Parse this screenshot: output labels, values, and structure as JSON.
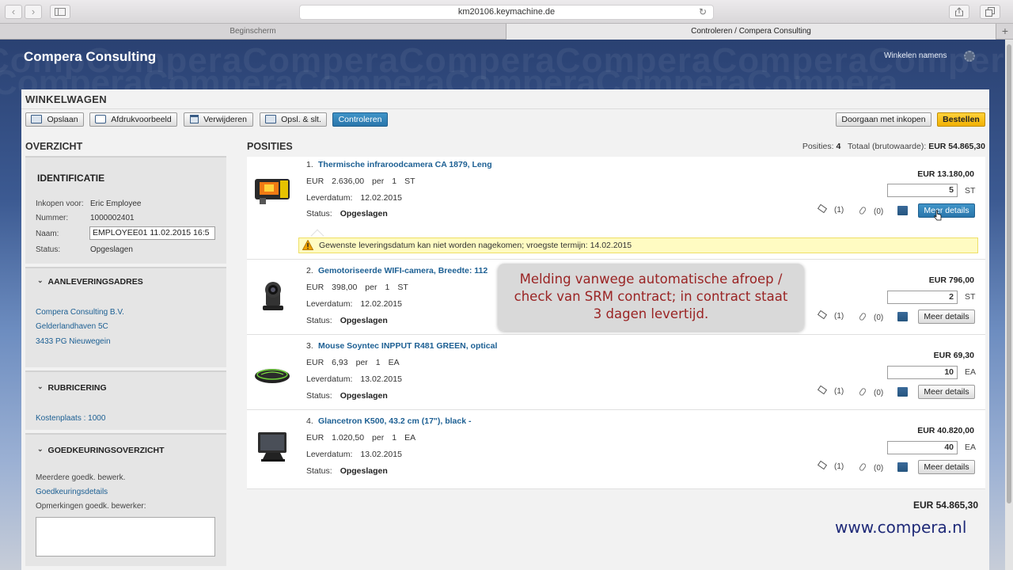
{
  "browser": {
    "url": "km20106.keymachine.de",
    "tabs": [
      {
        "label": "Beginscherm",
        "active": false
      },
      {
        "label": "Controleren / Compera Consulting",
        "active": true
      }
    ]
  },
  "header": {
    "company": "Compera Consulting",
    "shop_for": "Winkelen namens"
  },
  "cart": {
    "title": "WINKELWAGEN",
    "toolbar": {
      "save": "Opslaan",
      "print_preview": "Afdrukvoorbeeld",
      "delete": "Verwijderen",
      "save_close": "Opsl. & slt.",
      "check": "Controleren",
      "continue_shopping": "Doorgaan met inkopen",
      "order": "Bestellen"
    }
  },
  "overview": {
    "title": "OVERZICHT",
    "identification": {
      "title": "IDENTIFICATIE",
      "buy_for_label": "Inkopen voor:",
      "buy_for_value": "Eric Employee",
      "number_label": "Nummer:",
      "number_value": "1000002401",
      "name_label": "Naam:",
      "name_value": "EMPLOYEE01 11.02.2015 16:5",
      "status_label": "Status:",
      "status_value": "Opgeslagen"
    },
    "delivery": {
      "title": "AANLEVERINGSADRES",
      "line1": "Compera Consulting B.V.",
      "line2": "Gelderlandhaven  5C",
      "line3": "3433 PG  Nieuwegein"
    },
    "classification": {
      "title": "RUBRICERING",
      "cost_center": "Kostenplaats : 1000"
    },
    "approval": {
      "title": "GOEDKEURINGSOVERZICHT",
      "multiple": "Meerdere goedk. bewerk.",
      "details_link": "Goedkeuringsdetails",
      "remarks_label": "Opmerkingen goedk. bewerker:"
    }
  },
  "positions": {
    "title": "POSITIES",
    "count_label": "Posities:",
    "count": "4",
    "total_label": "Totaal (brutowaarde):",
    "total_value": "EUR  54.865,30",
    "grand_total": "EUR  54.865,30",
    "delivery_label": "Leverdatum:",
    "status_label": "Status:",
    "more_label": "Meer details",
    "items": [
      {
        "num": "1.",
        "name": "Thermische infraroodcamera CA 1879, Leng",
        "currency": "EUR",
        "price": "2.636,00",
        "per": "per",
        "per_qty": "1",
        "per_unit": "ST",
        "delivery": "12.02.2015",
        "status": "Opgeslagen",
        "total": "EUR   13.180,00",
        "qty": "5",
        "unit": "ST",
        "notes": "(1)",
        "attachments": "(0)"
      },
      {
        "num": "2.",
        "name": "Gemotoriseerde WIFI-camera, Breedte: 112",
        "currency": "EUR",
        "price": "398,00",
        "per": "per",
        "per_qty": "1",
        "per_unit": "ST",
        "delivery": "12.02.2015",
        "status": "Opgeslagen",
        "total": "EUR   796,00",
        "qty": "2",
        "unit": "ST",
        "notes": "(1)",
        "attachments": "(0)"
      },
      {
        "num": "3.",
        "name": "Mouse Soyntec INPPUT R481 GREEN, optical",
        "currency": "EUR",
        "price": "6,93",
        "per": "per",
        "per_qty": "1",
        "per_unit": "EA",
        "delivery": "13.02.2015",
        "status": "Opgeslagen",
        "total": "EUR   69,30",
        "qty": "10",
        "unit": "EA",
        "notes": "(1)",
        "attachments": "(0)"
      },
      {
        "num": "4.",
        "name": "Glancetron K500, 43.2 cm (17\"), black -",
        "currency": "EUR",
        "price": "1.020,50",
        "per": "per",
        "per_qty": "1",
        "per_unit": "EA",
        "delivery": "13.02.2015",
        "status": "Opgeslagen",
        "total": "EUR   40.820,00",
        "qty": "40",
        "unit": "EA",
        "notes": "(1)",
        "attachments": "(0)"
      }
    ],
    "warning": "Gewenste leveringsdatum kan niet worden nagekomen; vroegste termijn: 14.02.2015"
  },
  "callout": {
    "line1": "Melding vanwege automatische afroep /",
    "line2": "check van SRM contract; in contract staat",
    "line3": "3 dagen levertijd."
  },
  "website": "www.compera.nl",
  "colors": {
    "accent_blue": "#2a76ab",
    "order_yellow": "#f5b800",
    "link": "#1c5f93",
    "callout_text": "#9a2424"
  }
}
